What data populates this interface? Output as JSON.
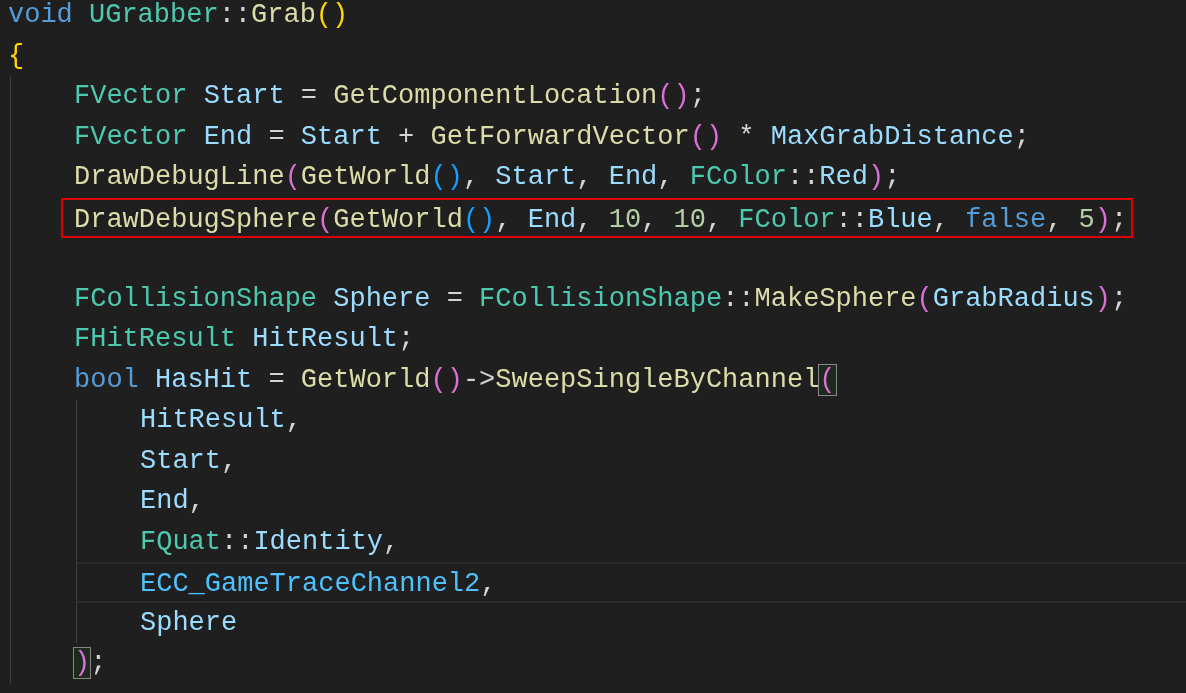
{
  "code": {
    "lines": [
      {
        "kind": "code",
        "tokens": [
          {
            "text": "void ",
            "kind": "keyword"
          },
          {
            "text": "UGrabber",
            "kind": "type"
          },
          {
            "text": "::",
            "kind": "plain"
          },
          {
            "text": "Grab",
            "kind": "function"
          },
          {
            "text": "()",
            "kind": "bracket1"
          }
        ]
      },
      {
        "kind": "code",
        "tokens": [
          {
            "text": "{",
            "kind": "bracket1"
          }
        ],
        "children": [
          {
            "kind": "code",
            "tokens": [
              {
                "text": "FVector ",
                "kind": "type"
              },
              {
                "text": "Start",
                "kind": "variable"
              },
              {
                "text": " = ",
                "kind": "plain"
              },
              {
                "text": "GetComponentLocation",
                "kind": "function"
              },
              {
                "text": "()",
                "kind": "bracket2"
              },
              {
                "text": ";",
                "kind": "plain"
              }
            ]
          },
          {
            "kind": "code",
            "tokens": [
              {
                "text": "FVector ",
                "kind": "type"
              },
              {
                "text": "End",
                "kind": "variable"
              },
              {
                "text": " = ",
                "kind": "plain"
              },
              {
                "text": "Start",
                "kind": "variable"
              },
              {
                "text": " + ",
                "kind": "plain"
              },
              {
                "text": "GetForwardVector",
                "kind": "function"
              },
              {
                "text": "()",
                "kind": "bracket2"
              },
              {
                "text": " * ",
                "kind": "plain"
              },
              {
                "text": "MaxGrabDistance",
                "kind": "variable"
              },
              {
                "text": ";",
                "kind": "plain"
              }
            ]
          },
          {
            "kind": "code",
            "tokens": [
              {
                "text": "DrawDebugLine",
                "kind": "function"
              },
              {
                "text": "(",
                "kind": "bracket2"
              },
              {
                "text": "GetWorld",
                "kind": "function"
              },
              {
                "text": "()",
                "kind": "bracket3"
              },
              {
                "text": ", ",
                "kind": "plain"
              },
              {
                "text": "Start",
                "kind": "variable"
              },
              {
                "text": ", ",
                "kind": "plain"
              },
              {
                "text": "End",
                "kind": "variable"
              },
              {
                "text": ", ",
                "kind": "plain"
              },
              {
                "text": "FColor",
                "kind": "type"
              },
              {
                "text": "::",
                "kind": "plain"
              },
              {
                "text": "Red",
                "kind": "variable"
              },
              {
                "text": ")",
                "kind": "bracket2"
              },
              {
                "text": ";",
                "kind": "plain"
              }
            ]
          },
          {
            "kind": "code",
            "boxed": true,
            "tokens": [
              {
                "text": "DrawDebugSphere",
                "kind": "function"
              },
              {
                "text": "(",
                "kind": "bracket2"
              },
              {
                "text": "GetWorld",
                "kind": "function"
              },
              {
                "text": "()",
                "kind": "bracket3"
              },
              {
                "text": ", ",
                "kind": "plain"
              },
              {
                "text": "End",
                "kind": "variable"
              },
              {
                "text": ", ",
                "kind": "plain"
              },
              {
                "text": "10",
                "kind": "number"
              },
              {
                "text": ", ",
                "kind": "plain"
              },
              {
                "text": "10",
                "kind": "number"
              },
              {
                "text": ", ",
                "kind": "plain"
              },
              {
                "text": "FColor",
                "kind": "type"
              },
              {
                "text": "::",
                "kind": "plain"
              },
              {
                "text": "Blue",
                "kind": "variable"
              },
              {
                "text": ", ",
                "kind": "plain"
              },
              {
                "text": "false",
                "kind": "keyword"
              },
              {
                "text": ", ",
                "kind": "plain"
              },
              {
                "text": "5",
                "kind": "number"
              },
              {
                "text": ")",
                "kind": "bracket2"
              },
              {
                "text": ";",
                "kind": "plain"
              }
            ]
          },
          {
            "kind": "blank"
          },
          {
            "kind": "code",
            "tokens": [
              {
                "text": "FCollisionShape ",
                "kind": "type"
              },
              {
                "text": "Sphere",
                "kind": "variable"
              },
              {
                "text": " = ",
                "kind": "plain"
              },
              {
                "text": "FCollisionShape",
                "kind": "type"
              },
              {
                "text": "::",
                "kind": "plain"
              },
              {
                "text": "MakeSphere",
                "kind": "function"
              },
              {
                "text": "(",
                "kind": "bracket2"
              },
              {
                "text": "GrabRadius",
                "kind": "variable"
              },
              {
                "text": ")",
                "kind": "bracket2"
              },
              {
                "text": ";",
                "kind": "plain"
              }
            ]
          },
          {
            "kind": "code",
            "tokens": [
              {
                "text": "FHitResult ",
                "kind": "type"
              },
              {
                "text": "HitResult",
                "kind": "variable"
              },
              {
                "text": ";",
                "kind": "plain"
              }
            ]
          },
          {
            "kind": "code",
            "tokens": [
              {
                "text": "bool ",
                "kind": "keyword"
              },
              {
                "text": "HasHit",
                "kind": "variable"
              },
              {
                "text": " = ",
                "kind": "plain"
              },
              {
                "text": "GetWorld",
                "kind": "function"
              },
              {
                "text": "()",
                "kind": "bracket2"
              },
              {
                "text": "->",
                "kind": "plain"
              },
              {
                "text": "SweepSingleByChannel",
                "kind": "function"
              },
              {
                "text": "(",
                "kind": "bracket2",
                "matched": true
              }
            ],
            "children": [
              {
                "kind": "code",
                "tokens": [
                  {
                    "text": "HitResult",
                    "kind": "variable"
                  },
                  {
                    "text": ",",
                    "kind": "plain"
                  }
                ]
              },
              {
                "kind": "code",
                "tokens": [
                  {
                    "text": "Start",
                    "kind": "variable"
                  },
                  {
                    "text": ",",
                    "kind": "plain"
                  }
                ]
              },
              {
                "kind": "code",
                "tokens": [
                  {
                    "text": "End",
                    "kind": "variable"
                  },
                  {
                    "text": ",",
                    "kind": "plain"
                  }
                ]
              },
              {
                "kind": "code",
                "tokens": [
                  {
                    "text": "FQuat",
                    "kind": "type"
                  },
                  {
                    "text": "::",
                    "kind": "plain"
                  },
                  {
                    "text": "Identity",
                    "kind": "variable"
                  },
                  {
                    "text": ",",
                    "kind": "plain"
                  }
                ]
              },
              {
                "kind": "code",
                "current": true,
                "tokens": [
                  {
                    "text": "ECC_GameTraceChannel2",
                    "kind": "enum"
                  },
                  {
                    "text": ",",
                    "kind": "plain"
                  }
                ]
              },
              {
                "kind": "code",
                "tokens": [
                  {
                    "text": "Sphere",
                    "kind": "variable"
                  }
                ]
              }
            ]
          },
          {
            "kind": "code",
            "tokens": [
              {
                "text": ")",
                "kind": "bracket2",
                "matched": true
              },
              {
                "text": ";",
                "kind": "plain"
              }
            ]
          }
        ]
      }
    ]
  }
}
